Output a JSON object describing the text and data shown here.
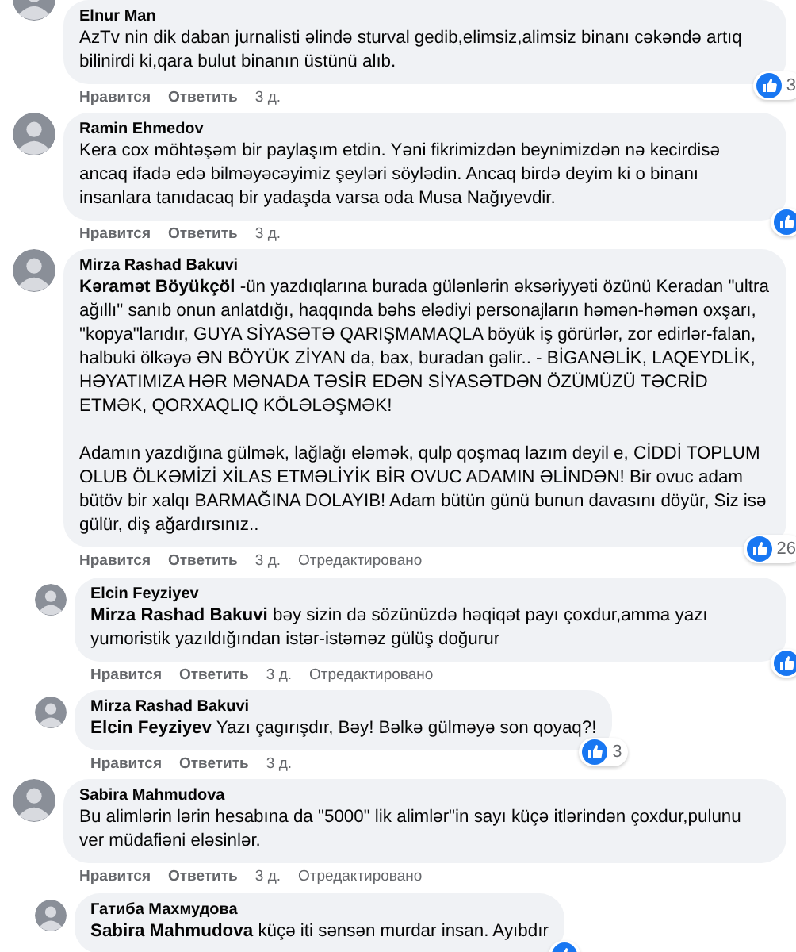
{
  "comments": [
    {
      "author": "Elnur Man",
      "paragraphs": [
        "AzTv nin dik daban jurnalisti əlində sturval gedib,elimsiz,alimsiz binanı cəkəndə artıq bilinirdi ki,qara bulut binanın üstünü alıb."
      ],
      "actions": [
        "Нравится",
        "Ответить",
        "3 д."
      ],
      "reacted": true,
      "reaction_count": "3"
    },
    {
      "author": "Ramin Ehmedov",
      "paragraphs": [
        "Kera cox möhtəşəm bir paylaşım etdin. Yəni fikrimizdən beynimizdən nə kecirdisə ancaq ifadə edə bilməyəcəyimiz şeyləri söylədin. Ancaq birdə deyim ki o binanı insanlara tanıdacaq bir yadaşda varsa oda Musa Nağıyevdir."
      ],
      "actions": [
        "Нравится",
        "Ответить",
        "3 д."
      ],
      "reacted": true
    },
    {
      "author": "Mirza Rashad Bakuvi",
      "mention": "Kəramət Böyükçöl",
      "paragraphs": [
        "-ün yazdıqlarına burada gülənlərin əksəriyyəti özünü Keradan \"ultra ağıllı\" sanıb onun anlatdığı, haqqında bəhs elədiyi personajların həmən-həmən oxşarı, \"kopya\"larıdır, GUYA SİYASƏTƏ QARIŞMAMAQLA böyük iş görürlər, zor edirlər-falan, halbuki ölkəyə ƏN BÖYÜK ZİYAN da, bax, buradan gəlir.. - BİGANƏLİK, LAQEYDLİK, HƏYATIMIZA HƏR MƏNADA TƏSİR EDƏN SİYASƏTDƏN ÖZÜMÜZÜ TƏCRİD ETMƏK, QORXAQLIQ KÖLƏLƏŞMƏK!",
        "Adamın yazdığına gülmək, lağlağı eləmək, qulp qoşmaq lazım deyil e, CİDDİ TOPLUM OLUB ÖLKƏMİZİ XİLAS ETMƏLİYİK BİR OVUC ADAMIN ƏLİNDƏN! Bir ovuc adam bütöv bir xalqı BARMAĞINA DOLAYIB! Adam bütün günü bunun davasını döyür, Siz isə gülür, diş ağardırsınız.."
      ],
      "actions": [
        "Нравится",
        "Ответить",
        "3 д.",
        "Отредактировано"
      ],
      "reacted": true,
      "reaction_count": "26",
      "replies": [
        {
          "author": "Elcin Feyziyev",
          "mention": "Mirza Rashad Bakuvi",
          "paragraphs": [
            "bəy sizin də sözünüzdə həqiqət payı çoxdur,amma yazı yumoristik yazıldığından istər-istəməz gülüş doğurur"
          ],
          "actions": [
            "Нравится",
            "Ответить",
            "3 д.",
            "Отредактировано"
          ],
          "reacted": true
        },
        {
          "author": "Mirza Rashad Bakuvi",
          "mention": "Elcin Feyziyev",
          "paragraphs": [
            "Yazı çagırışdır, Bəy! Bəlkə gülməyə son qoyaq?!"
          ],
          "actions": [
            "Нравится",
            "Ответить",
            "3 д."
          ],
          "reacted": true,
          "reaction_count": "3"
        }
      ]
    },
    {
      "author": "Sabira Mahmudova",
      "paragraphs": [
        "Bu alimlərin lərin hesabına da \"5000\" lik alimlər\"in sayı küçə itlərindən çoxdur,pulunu ver müdafiəni eləsinlər."
      ],
      "actions": [
        "Нравится",
        "Ответить",
        "3 д.",
        "Отредактировано"
      ],
      "reacted": false,
      "replies": [
        {
          "author": "Гатиба Махмудова",
          "mention": "Sabira Mahmudova",
          "paragraphs": [
            "küçə iti sənsən murdar insan. Ayıbdır"
          ],
          "reacted": true
        }
      ]
    }
  ]
}
